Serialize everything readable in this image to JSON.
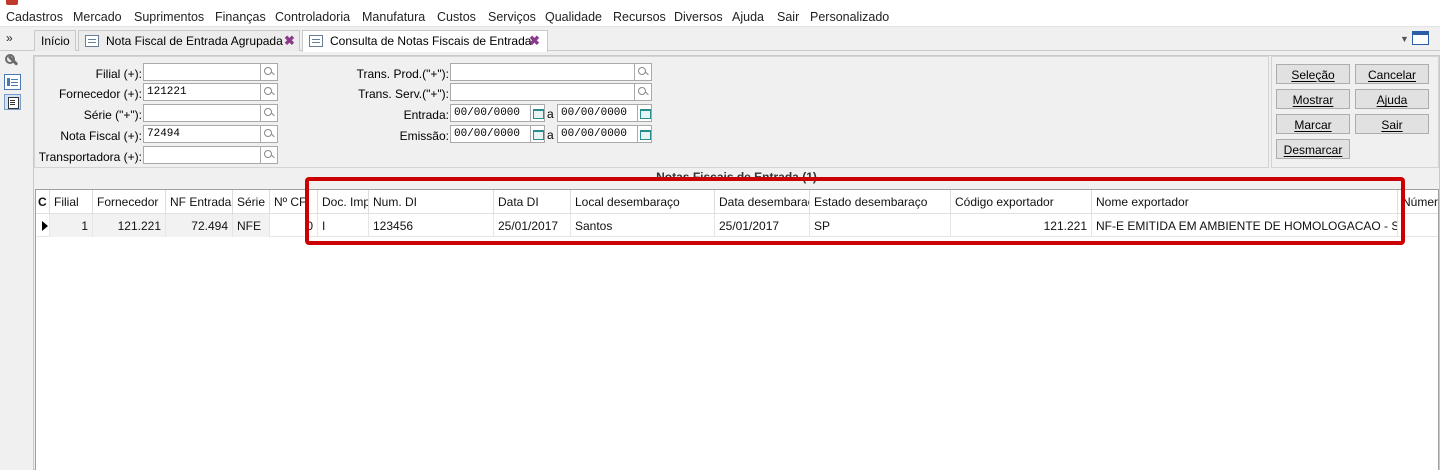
{
  "menu": [
    "Cadastros",
    "Mercado",
    "Suprimentos",
    "Finanças",
    "Controladoria",
    "Manufatura",
    "Custos",
    "Serviços",
    "Qualidade",
    "Recursos",
    "Diversos",
    "Ajuda",
    "Sair",
    "Personalizado"
  ],
  "tabs": {
    "chevron": "»",
    "home": "Início",
    "tab1": "Nota Fiscal de Entrada Agrupada",
    "tab2": "Consulta de Notas Fiscais de Entrada",
    "close_glyph": "✖"
  },
  "filters": {
    "filial_label": "Filial (+):",
    "filial_value": "",
    "fornecedor_label": "Fornecedor (+):",
    "fornecedor_value": "121221",
    "serie_label": "Série (\"+\"):",
    "serie_value": "",
    "nota_label": "Nota Fiscal (+):",
    "nota_value": "72494",
    "transportadora_label": "Transportadora (+):",
    "transportadora_value": "",
    "trans_prod_label": "Trans. Prod.(\"+\"):",
    "trans_prod_value": "",
    "trans_serv_label": "Trans. Serv.(\"+\"):",
    "trans_serv_value": "",
    "entrada_label": "Entrada:",
    "entrada_from": "00/00/0000",
    "entrada_to": "00/00/0000",
    "emissao_label": "Emissão:",
    "emissao_from": "00/00/0000",
    "emissao_to": "00/00/0000",
    "range_sep": "a"
  },
  "buttons": {
    "selecao": "Seleção",
    "cancelar": "Cancelar",
    "mostrar": "Mostrar",
    "ajuda": "Ajuda",
    "marcar": "Marcar",
    "sair": "Sair",
    "desmarcar": "Desmarcar"
  },
  "grid": {
    "title": "Notas Fiscais de Entrada (1)",
    "columns": [
      "C",
      "Filial",
      "Fornecedor",
      "NF Entrada",
      "Série",
      "Nº CF",
      "Doc. Imp",
      "Num. DI",
      "Data DI",
      "Local desembaraço",
      "Data desembaraço",
      "Estado desembaraço",
      "Código exportador",
      "Nome exportador",
      "Númer"
    ],
    "row": {
      "filial": "1",
      "fornecedor": "121.221",
      "nf_entrada": "72.494",
      "serie": "NFE",
      "n_cf": "0",
      "doc_imp": "I",
      "num_di": "123456",
      "data_di": "25/01/2017",
      "local_desembaraco": "Santos",
      "data_desembaraco": "25/01/2017",
      "estado_desembaraco": "SP",
      "codigo_exportador": "121.221",
      "nome_exportador": "NF-E EMITIDA EM AMBIENTE DE HOMOLOGACAO - SEM VA"
    }
  },
  "highlight_color": "#cc0000"
}
